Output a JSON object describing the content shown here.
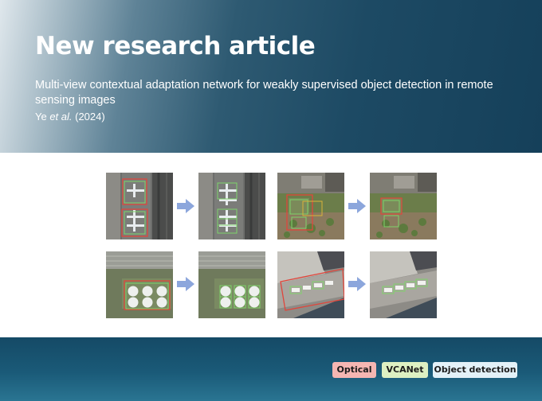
{
  "header": {
    "title": "New research article",
    "subtitle": "Multi-view contextual adaptation network for weakly supervised object detection in remote sensing images",
    "authors_prefix": "Ye ",
    "authors_etal": "et al.",
    "year": " (2024)"
  },
  "tags": [
    {
      "label": "Optical",
      "color": "#f5b6b2"
    },
    {
      "label": "VCANet",
      "color": "#ddf0c2"
    },
    {
      "label": "Object detection",
      "color": "#e3f1f8"
    }
  ],
  "figure": {
    "arrow_color": "#8ca6dc",
    "box_colors": {
      "red": "#e0463c",
      "green": "#7ed36a"
    }
  }
}
